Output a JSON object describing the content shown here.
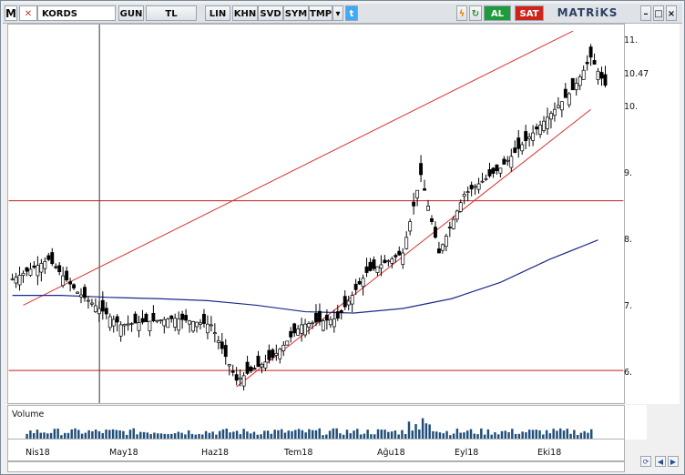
{
  "toolbar": {
    "logo": "M",
    "symbol": "KORDS",
    "buttons": [
      "GUN",
      "TL",
      "LIN",
      "KHN",
      "SVD",
      "SYM",
      "TMP"
    ],
    "al_label": "AL",
    "sat_label": "SAT",
    "brand": "MATRiKS"
  },
  "colors": {
    "up": "#ffffff",
    "down": "#000000",
    "channel": "#e03030",
    "ma": "#1a2a8a",
    "volume": "#1f4e7a",
    "hline": "#c02020"
  },
  "y_ticks": [
    "11.",
    "10.47",
    "10.",
    "9.",
    "8.",
    "7.",
    "6."
  ],
  "volume_label": "Volume",
  "x_labels": [
    "Nis18",
    "May18",
    "Haz18",
    "Tem18",
    "Ağu18",
    "Eyl18",
    "Eki18"
  ],
  "chart_data": {
    "type": "candlestick",
    "symbol": "KORDS",
    "ylim": [
      5.6,
      11.4
    ],
    "y_ticks": [
      11,
      10,
      9,
      8,
      7,
      6
    ],
    "last_price": 10.47,
    "horizontal_lines": [
      8.7,
      6.1
    ],
    "channel": {
      "upper": [
        [
          3,
          7.1
        ],
        [
          155,
          11.3
        ]
      ],
      "lower": [
        [
          62,
          5.85
        ],
        [
          160,
          10.1
        ]
      ]
    },
    "ma_line": [
      7.25,
      7.25,
      7.22,
      7.2,
      7.17,
      7.1,
      7.0,
      6.98,
      7.05,
      7.2,
      7.45,
      7.8,
      8.1
    ],
    "x_labels": [
      "Nis18",
      "May18",
      "Haz18",
      "Tem18",
      "Ağu18",
      "Eyl18",
      "Eki18"
    ]
  }
}
